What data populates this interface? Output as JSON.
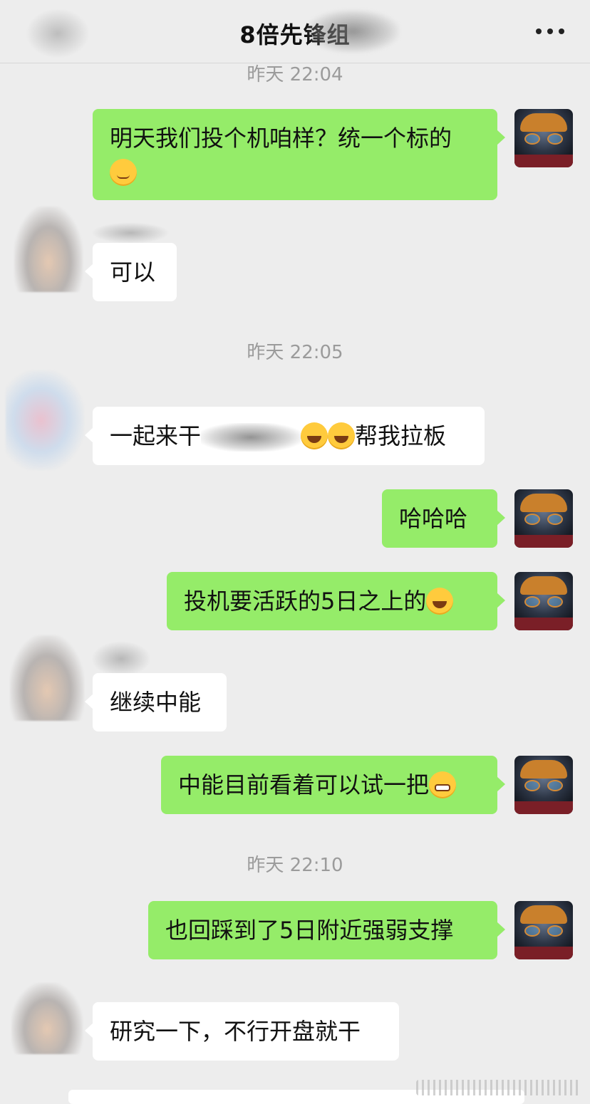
{
  "header": {
    "title": "8倍先锋组",
    "more_icon": "more-dots-icon"
  },
  "timestamps": [
    "昨天 22:04",
    "昨天 22:05",
    "昨天 22:10"
  ],
  "messages": [
    {
      "from": "me",
      "text": "明天我们投个机咱样？统一个标的",
      "emoji": "smirk-emoji"
    },
    {
      "from": "them",
      "text": "可以"
    },
    {
      "from": "them",
      "text_before": "一起来干",
      "text_after": "帮我拉板",
      "emoji": "laugh-cry-emoji"
    },
    {
      "from": "me",
      "text": "哈哈哈"
    },
    {
      "from": "me",
      "text": "投机要活跃的5日之上的",
      "emoji": "laugh-cry-emoji"
    },
    {
      "from": "them",
      "text": "继续中能"
    },
    {
      "from": "me",
      "text": "中能目前看着可以试一把",
      "emoji": "grin-emoji"
    },
    {
      "from": "me",
      "text": "也回踩到了5日附近强弱支撑"
    },
    {
      "from": "them",
      "text": "研究一下，不行开盘就干"
    }
  ],
  "colors": {
    "outgoing_bubble": "#95ec69",
    "incoming_bubble": "#ffffff",
    "background": "#ededed",
    "timestamp": "#9b9b9b"
  }
}
